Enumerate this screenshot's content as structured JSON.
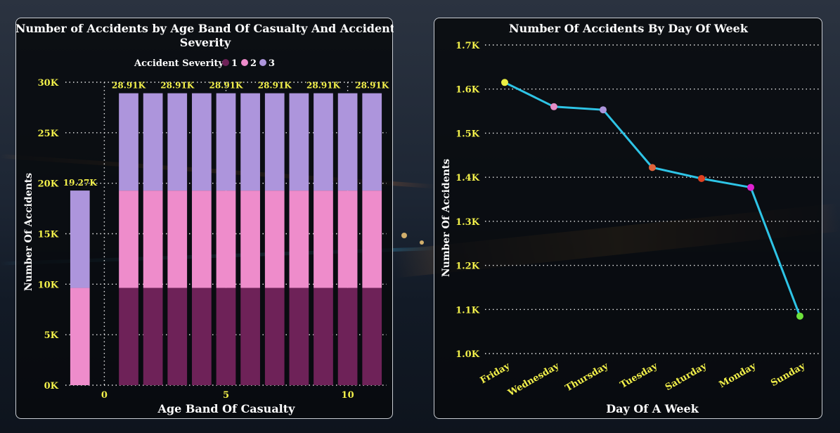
{
  "colors": {
    "severity_1": "#6e2258",
    "severity_2": "#ee8ccb",
    "severity_3": "#ad95dc",
    "label_yellow": "#f2f04a",
    "line": "#2ec4e6",
    "text_white": "#ffffff"
  },
  "chart_data": [
    {
      "type": "bar",
      "stacked": true,
      "title": "Number of Accidents by Age Band Of Casualty And Accident Severity",
      "title_line1": "Number of Accidents by Age Band Of Casualty And Accident",
      "title_line2": "Severity",
      "xlabel": "Age Band Of Casualty",
      "ylabel": "Number Of Accidents",
      "legend_title": "Accident Severity",
      "legend_placement": "top",
      "x": [
        -1,
        1,
        2,
        3,
        4,
        5,
        6,
        7,
        8,
        9,
        10,
        11
      ],
      "xlim": [
        -1.6,
        11.6
      ],
      "x_ticks": [
        0,
        5,
        10
      ],
      "x_tick_labels": [
        "0",
        "5",
        "10"
      ],
      "ylim": [
        0,
        30000
      ],
      "y_ticks": [
        0,
        5000,
        10000,
        15000,
        20000,
        25000,
        30000
      ],
      "y_tick_labels": [
        "0K",
        "5K",
        "10K",
        "15K",
        "20K",
        "25K",
        "30K"
      ],
      "series": [
        {
          "name": "1",
          "values": [
            0,
            9637,
            9637,
            9637,
            9637,
            9637,
            9637,
            9637,
            9637,
            9637,
            9637,
            9637
          ]
        },
        {
          "name": "2",
          "values": [
            9637,
            9637,
            9637,
            9637,
            9637,
            9637,
            9637,
            9637,
            9637,
            9637,
            9637,
            9637
          ]
        },
        {
          "name": "3",
          "values": [
            9637,
            9637,
            9637,
            9637,
            9637,
            9637,
            9637,
            9637,
            9637,
            9637,
            9637,
            9637
          ]
        }
      ],
      "data_labels": [
        {
          "x": -1,
          "text": "19.27K"
        },
        {
          "x": 1,
          "text": "28.91K"
        },
        {
          "x": 3,
          "text": "28.91K"
        },
        {
          "x": 5,
          "text": "28.91K"
        },
        {
          "x": 7,
          "text": "28.91K"
        },
        {
          "x": 9,
          "text": "28.91K"
        },
        {
          "x": 11,
          "text": "28.91K"
        }
      ],
      "grid": true
    },
    {
      "type": "line",
      "title": "Number Of Accidents By Day Of Week",
      "xlabel": "Day Of A Week",
      "ylabel": "Number Of Accidents",
      "categories": [
        "Friday",
        "Wednesday",
        "Thursday",
        "Tuesday",
        "Saturday",
        "Monday",
        "Sunday"
      ],
      "values": [
        1615,
        1560,
        1553,
        1422,
        1397,
        1377,
        1085
      ],
      "point_colors": [
        "#e9ee43",
        "#e58cc6",
        "#ad95dc",
        "#e0633a",
        "#e0401f",
        "#e022d0",
        "#6ee13b"
      ],
      "ylim": [
        1000,
        1700
      ],
      "y_ticks": [
        1000,
        1100,
        1200,
        1300,
        1400,
        1500,
        1600,
        1700
      ],
      "y_tick_labels": [
        "1.0K",
        "1.1K",
        "1.2K",
        "1.3K",
        "1.4K",
        "1.5K",
        "1.6K",
        "1.7K"
      ],
      "grid": true
    }
  ]
}
